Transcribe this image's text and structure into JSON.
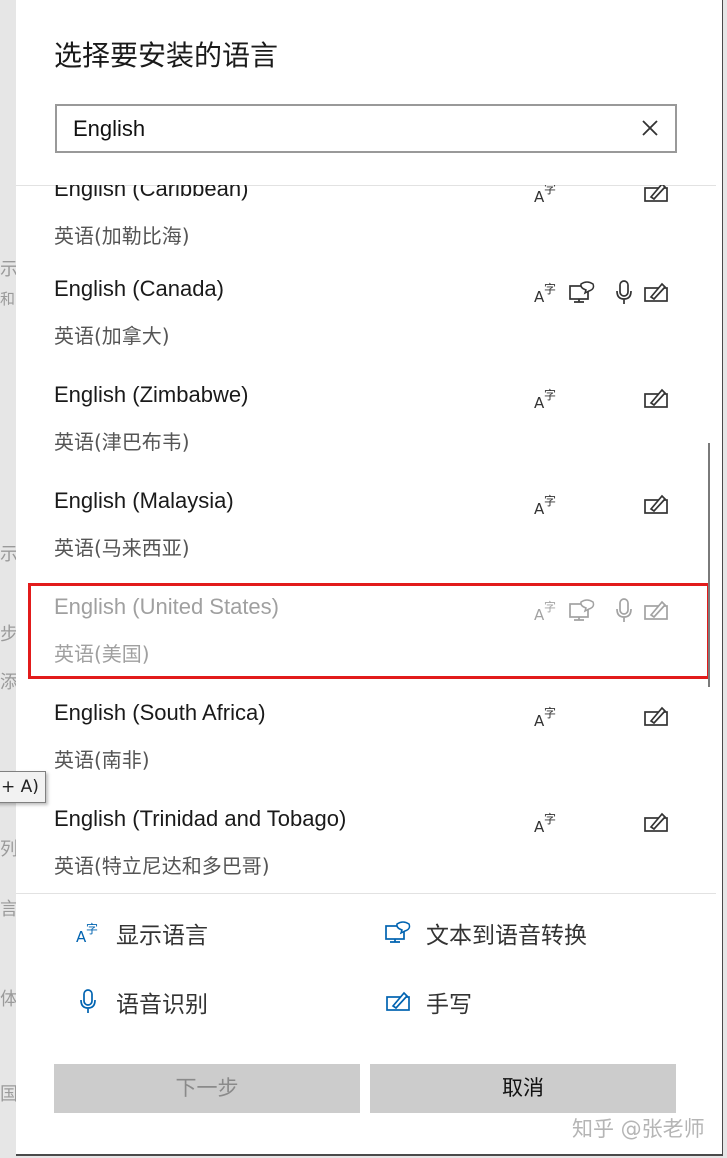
{
  "dialog": {
    "title": "选择要安装的语言",
    "search": {
      "value": "English"
    },
    "languages": [
      {
        "name": "English (Caribbean)",
        "native": "英语(加勒比海)",
        "features": [
          "display",
          "handwriting"
        ]
      },
      {
        "name": "English (Canada)",
        "native": "英语(加拿大)",
        "features": [
          "display",
          "tts",
          "speech",
          "handwriting"
        ]
      },
      {
        "name": "English (Zimbabwe)",
        "native": "英语(津巴布韦)",
        "features": [
          "display",
          "handwriting"
        ]
      },
      {
        "name": "English (Malaysia)",
        "native": "英语(马来西亚)",
        "features": [
          "display",
          "handwriting"
        ]
      },
      {
        "name": "English (United States)",
        "native": "英语(美国)",
        "features": [
          "display",
          "tts",
          "speech",
          "handwriting"
        ],
        "disabled": true,
        "highlighted": true
      },
      {
        "name": "English (South Africa)",
        "native": "英语(南非)",
        "features": [
          "display",
          "handwriting"
        ]
      },
      {
        "name": "English (Trinidad and Tobago)",
        "native": "英语(特立尼达和多巴哥)",
        "features": [
          "display",
          "handwriting"
        ]
      }
    ],
    "legend": {
      "display": "显示语言",
      "tts": "文本到语音转换",
      "speech": "语音识别",
      "handwriting": "手写"
    },
    "buttons": {
      "next": "下一步",
      "cancel": "取消"
    }
  },
  "background": {
    "tooltip": "+ A)"
  },
  "watermark": "知乎 @张老师",
  "colors": {
    "accent": "#0063b1",
    "highlight_border": "#e21b1b",
    "button_bg": "#cccccc"
  }
}
